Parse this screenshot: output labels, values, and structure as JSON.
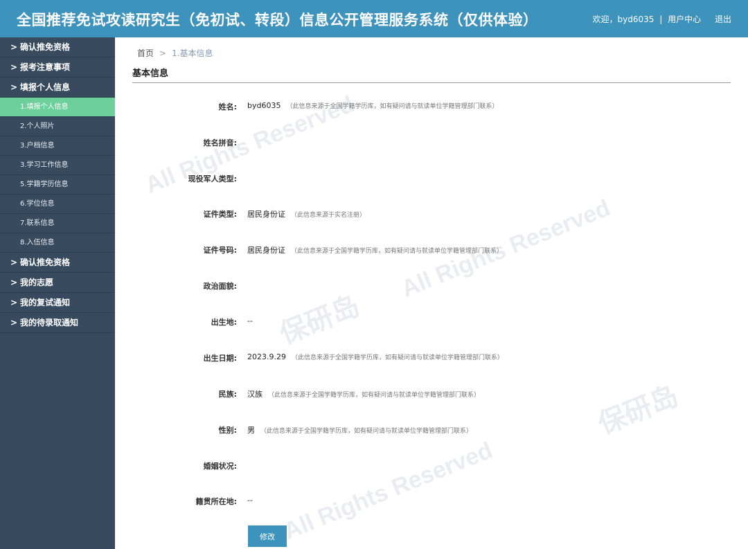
{
  "header": {
    "title": "全国推荐免试攻读研究生（免初试、转段）信息公开管理服务系统（仅供体验）",
    "welcome": "欢迎，byd6035",
    "separator": "|",
    "user_center": "用户中心",
    "logout": "退出"
  },
  "sidebar": {
    "items": [
      {
        "label": "确认推免资格"
      },
      {
        "label": "报考注意事项"
      },
      {
        "label": "填报个人信息"
      },
      {
        "label": "1.填报个人信息"
      },
      {
        "label": "2.个人照片"
      },
      {
        "label": "3.户档信息"
      },
      {
        "label": "3.学习工作信息"
      },
      {
        "label": "5.学籍学历信息"
      },
      {
        "label": "6.学位信息"
      },
      {
        "label": "7.联系信息"
      },
      {
        "label": "8.入伍信息"
      },
      {
        "label": "确认推免资格"
      },
      {
        "label": "我的志愿"
      },
      {
        "label": "我的复试通知"
      },
      {
        "label": "我的待录取通知"
      }
    ],
    "chevron": ">"
  },
  "breadcrumb": {
    "home": "首页",
    "sep": ">",
    "current": "1.基本信息"
  },
  "section_title": "基本信息",
  "fields": [
    {
      "label": "姓名:",
      "value": "byd6035",
      "note": "（此信息来源于全国学籍学历库，如有疑问请与就读单位学籍管理部门联系）"
    },
    {
      "label": "姓名拼音:",
      "value": "",
      "note": ""
    },
    {
      "label": "现役军人类型:",
      "value": "",
      "note": ""
    },
    {
      "label": "证件类型:",
      "value": "居民身份证",
      "note": "（此信息来源于实名注册）"
    },
    {
      "label": "证件号码:",
      "value": "居民身份证",
      "note": "（此信息来源于全国学籍学历库，如有疑问请与就读单位学籍管理部门联系）"
    },
    {
      "label": "政治面貌:",
      "value": "",
      "note": ""
    },
    {
      "label": "出生地:",
      "value": "--",
      "note": ""
    },
    {
      "label": "出生日期:",
      "value": "2023.9.29",
      "note": "（此信息来源于全国学籍学历库，如有疑问请与就读单位学籍管理部门联系）"
    },
    {
      "label": "民族:",
      "value": "汉族",
      "note": "（此信息来源于全国学籍学历库，如有疑问请与就读单位学籍管理部门联系）"
    },
    {
      "label": "性别:",
      "value": "男",
      "note": "（此信息来源于全国学籍学历库，如有疑问请与就读单位学籍管理部门联系）"
    },
    {
      "label": "婚姻状况:",
      "value": "",
      "note": ""
    },
    {
      "label": "籍贯所在地:",
      "value": "--",
      "note": ""
    }
  ],
  "edit_button": "修改",
  "watermark": {
    "brand": "保研岛",
    "rights": "All Rights Reserved"
  }
}
